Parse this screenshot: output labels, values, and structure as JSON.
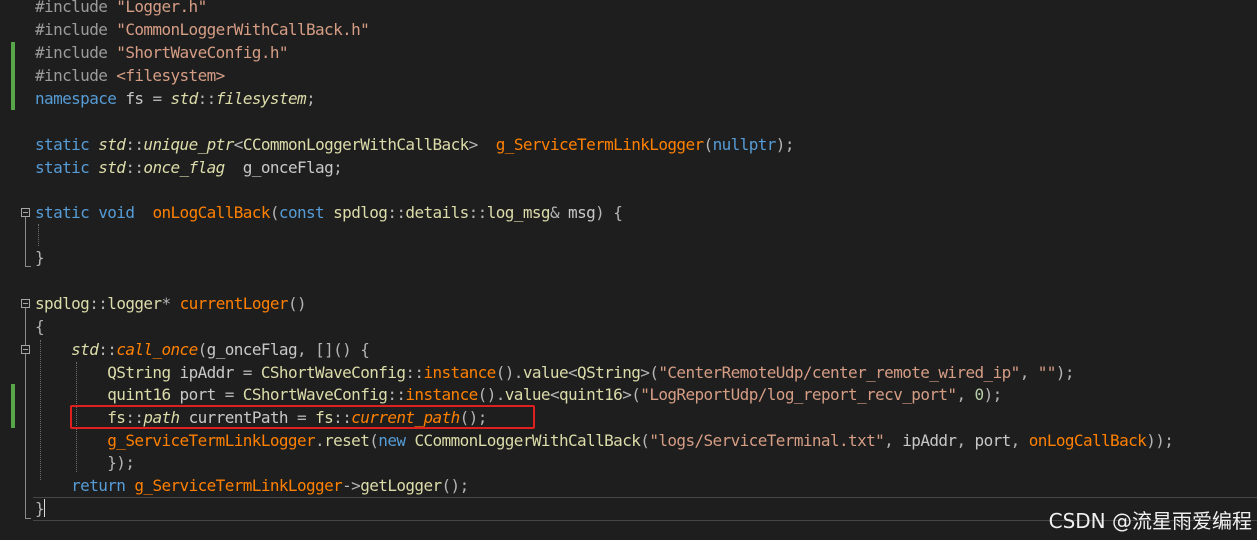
{
  "editor": {
    "lines": [
      {
        "id": "l1",
        "tokens": [
          [
            "pre",
            "#include "
          ],
          [
            "str",
            "\"Logger.h\""
          ]
        ]
      },
      {
        "id": "l2",
        "tokens": [
          [
            "pre",
            "#include "
          ],
          [
            "str",
            "\"CommonLoggerWithCallBack.h\""
          ]
        ]
      },
      {
        "id": "l3",
        "tokens": [
          [
            "pre",
            "#include "
          ],
          [
            "str",
            "\"ShortWaveConfig.h\""
          ]
        ]
      },
      {
        "id": "l4",
        "tokens": [
          [
            "pre",
            "#include "
          ],
          [
            "str",
            "<filesystem>"
          ]
        ]
      },
      {
        "id": "l5",
        "tokens": [
          [
            "kw",
            "namespace "
          ],
          [
            "ns",
            "fs "
          ],
          [
            "punct",
            "= "
          ],
          [
            "tyit",
            "std"
          ],
          [
            "punct",
            "::"
          ],
          [
            "tyit",
            "filesystem"
          ],
          [
            "punct",
            ";"
          ]
        ]
      },
      {
        "id": "l6",
        "tokens": []
      },
      {
        "id": "l7",
        "tokens": [
          [
            "kw",
            "static "
          ],
          [
            "tyit",
            "std"
          ],
          [
            "punct",
            "::"
          ],
          [
            "tyit",
            "unique_ptr"
          ],
          [
            "punct",
            "<"
          ],
          [
            "cls-y",
            "CCommonLoggerWithCallBack"
          ],
          [
            "punct",
            ">  "
          ],
          [
            "global",
            "g_ServiceTermLinkLogger"
          ],
          [
            "punct",
            "("
          ],
          [
            "kw",
            "nullptr"
          ],
          [
            "punct",
            ");"
          ]
        ]
      },
      {
        "id": "l8",
        "tokens": [
          [
            "kw",
            "static "
          ],
          [
            "tyit",
            "std"
          ],
          [
            "punct",
            "::"
          ],
          [
            "tyit",
            "once_flag"
          ],
          [
            "var",
            "  g_onceFlag"
          ],
          [
            "punct",
            ";"
          ]
        ]
      },
      {
        "id": "l9",
        "tokens": []
      },
      {
        "id": "l10",
        "tokens": [
          [
            "kw",
            "static void  "
          ],
          [
            "fn",
            "onLogCallBack"
          ],
          [
            "punct",
            "("
          ],
          [
            "kw",
            "const "
          ],
          [
            "cls-y",
            "spdlog"
          ],
          [
            "punct",
            "::"
          ],
          [
            "cls-y",
            "details"
          ],
          [
            "punct",
            "::"
          ],
          [
            "cls-y",
            "log_msg"
          ],
          [
            "punct",
            "& "
          ],
          [
            "var",
            "msg"
          ],
          [
            "punct",
            ") {"
          ]
        ]
      },
      {
        "id": "l11",
        "tokens": []
      },
      {
        "id": "l12",
        "tokens": [
          [
            "punct",
            "}"
          ]
        ]
      },
      {
        "id": "l13",
        "tokens": []
      },
      {
        "id": "l14",
        "tokens": [
          [
            "cls-y",
            "spdlog"
          ],
          [
            "punct",
            "::"
          ],
          [
            "cls-y",
            "logger"
          ],
          [
            "punct",
            "* "
          ],
          [
            "fn",
            "currentLoger"
          ],
          [
            "punct",
            "()"
          ]
        ]
      },
      {
        "id": "l15",
        "tokens": [
          [
            "punct",
            "{"
          ]
        ]
      },
      {
        "id": "l16",
        "tokens": [
          [
            "punct",
            "    "
          ],
          [
            "tyit",
            "std"
          ],
          [
            "punct",
            "::"
          ],
          [
            "italic-fn",
            "call_once"
          ],
          [
            "punct",
            "("
          ],
          [
            "var",
            "g_onceFlag"
          ],
          [
            "punct",
            ", []() {"
          ]
        ]
      },
      {
        "id": "l17",
        "tokens": [
          [
            "punct",
            "        "
          ],
          [
            "cls-y",
            "QString "
          ],
          [
            "var",
            "ipAddr "
          ],
          [
            "punct",
            "= "
          ],
          [
            "cls-y",
            "CShortWaveConfig"
          ],
          [
            "punct",
            "::"
          ],
          [
            "fn",
            "instance"
          ],
          [
            "punct",
            "()."
          ],
          [
            "cls-y",
            "value"
          ],
          [
            "punct",
            "<"
          ],
          [
            "cls-y",
            "QString"
          ],
          [
            "punct",
            ">("
          ],
          [
            "str",
            "\"CenterRemoteUdp/center_remote_wired_ip\""
          ],
          [
            "punct",
            ", "
          ],
          [
            "str",
            "\"\""
          ],
          [
            "punct",
            ");"
          ]
        ]
      },
      {
        "id": "l18",
        "tokens": [
          [
            "punct",
            "        "
          ],
          [
            "cls-y",
            "quint16 "
          ],
          [
            "var",
            "port "
          ],
          [
            "punct",
            "= "
          ],
          [
            "cls-y",
            "CShortWaveConfig"
          ],
          [
            "punct",
            "::"
          ],
          [
            "fn",
            "instance"
          ],
          [
            "punct",
            "()."
          ],
          [
            "cls-y",
            "value"
          ],
          [
            "punct",
            "<"
          ],
          [
            "cls-y",
            "quint16"
          ],
          [
            "punct",
            ">("
          ],
          [
            "str",
            "\"LogReportUdp/log_report_recv_port\""
          ],
          [
            "punct",
            ", "
          ],
          [
            "num",
            "0"
          ],
          [
            "punct",
            ");"
          ]
        ]
      },
      {
        "id": "l19",
        "tokens": [
          [
            "punct",
            "        "
          ],
          [
            "cls-y",
            "fs"
          ],
          [
            "punct",
            "::"
          ],
          [
            "tyit",
            "path "
          ],
          [
            "var",
            "currentPath "
          ],
          [
            "punct",
            "= "
          ],
          [
            "cls-y",
            "fs"
          ],
          [
            "punct",
            "::"
          ],
          [
            "italic-fn",
            "current_path"
          ],
          [
            "punct",
            "();"
          ]
        ]
      },
      {
        "id": "l20",
        "tokens": [
          [
            "punct",
            "        "
          ],
          [
            "global",
            "g_ServiceTermLinkLogger"
          ],
          [
            "punct",
            "."
          ],
          [
            "cls-y",
            "reset"
          ],
          [
            "punct",
            "("
          ],
          [
            "kw",
            "new "
          ],
          [
            "cls-y",
            "CCommonLoggerWithCallBack"
          ],
          [
            "punct",
            "("
          ],
          [
            "str",
            "\"logs/ServiceTerminal.txt\""
          ],
          [
            "punct",
            ", "
          ],
          [
            "var",
            "ipAddr"
          ],
          [
            "punct",
            ", "
          ],
          [
            "var",
            "port"
          ],
          [
            "punct",
            ", "
          ],
          [
            "fn",
            "onLogCallBack"
          ],
          [
            "punct",
            "));"
          ]
        ]
      },
      {
        "id": "l21",
        "tokens": [
          [
            "punct",
            "        });"
          ]
        ]
      },
      {
        "id": "l22",
        "tokens": [
          [
            "punct",
            "    "
          ],
          [
            "kw",
            "return "
          ],
          [
            "global",
            "g_ServiceTermLinkLogger"
          ],
          [
            "punct",
            "->"
          ],
          [
            "cls-y",
            "getLogger"
          ],
          [
            "punct",
            "();"
          ]
        ]
      },
      {
        "id": "l23",
        "tokens": [
          [
            "punct",
            "}"
          ]
        ]
      }
    ]
  },
  "watermark": {
    "text": "CSDN @流星雨爱编程"
  },
  "colors": {
    "background": "#1e1e1e",
    "highlight": "#e02020",
    "change_bar": "#57a64a"
  }
}
